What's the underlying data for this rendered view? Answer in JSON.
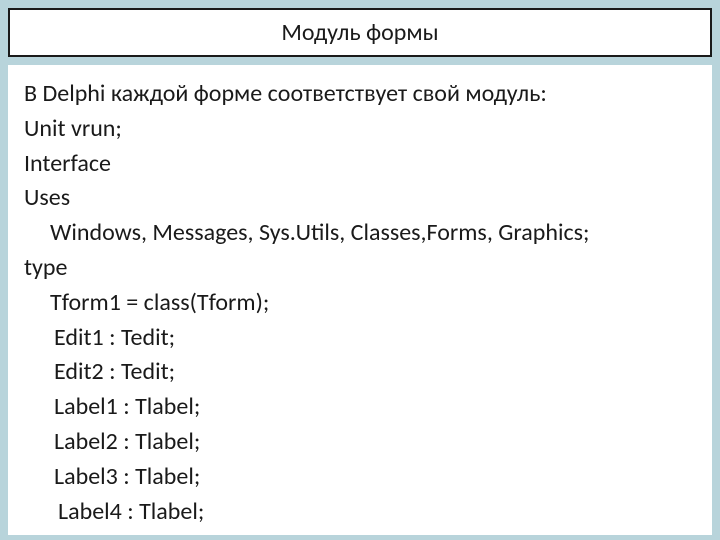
{
  "title": "Модуль формы",
  "lines": {
    "l0": "В Delphi каждой форме соответствует свой модуль:",
    "l1": "Unit  vrun;",
    "l2": "Interface",
    "l3": "Uses",
    "l4": "Windows, Messages, Sys.Utils, Classes,Forms, Graphics;",
    "l5": "type",
    "l6": "Tform1 = class(Tform);",
    "l7": "Edit1 : Tedit;",
    "l8": "Edit2 : Tedit;",
    "l9": "Label1 : Tlabel;",
    "l10": "Label2 : Tlabel;",
    "l11": "Label3 : Tlabel;",
    "l12": "Label4 : Tlabel;"
  }
}
